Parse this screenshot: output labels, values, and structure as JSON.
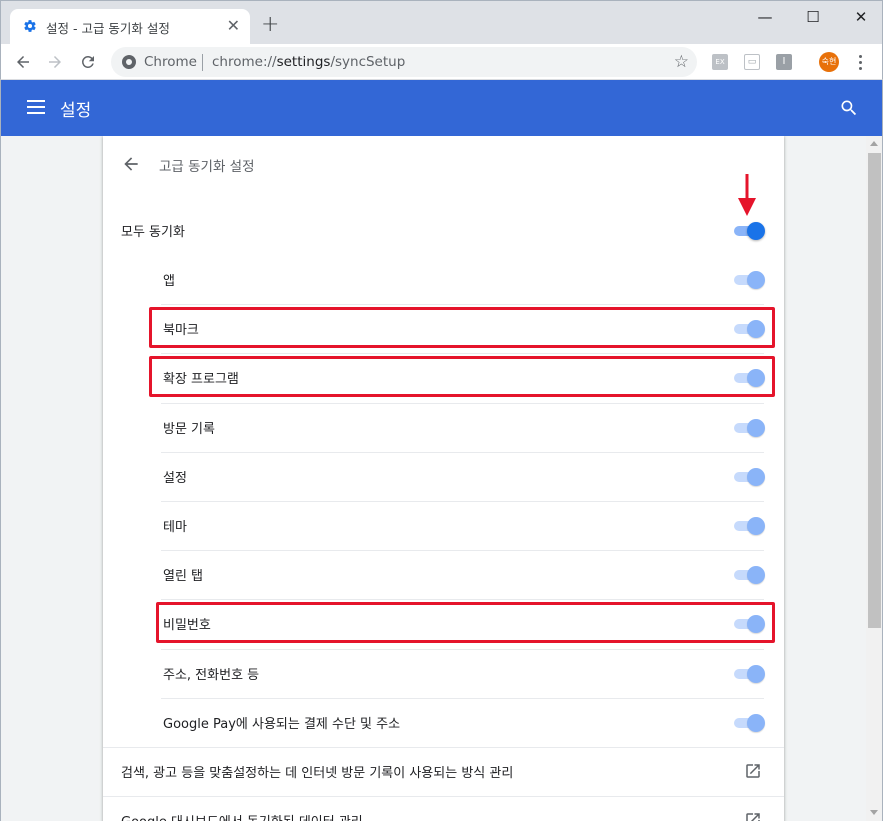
{
  "browser": {
    "tab_title": "설정 - 고급 동기화 설정",
    "tab_close": "✕",
    "new_tab": "+",
    "window_controls": {
      "minimize": "—",
      "maximize": "☐",
      "close": "✕"
    },
    "omnibox": {
      "label": "Chrome",
      "url_prefix": "chrome://",
      "url_host": "settings",
      "url_path": "/syncSetup"
    },
    "extensions": [
      "EX",
      "▭",
      "I"
    ],
    "avatar_text": "숙현"
  },
  "header": {
    "title": "설정"
  },
  "subpage": {
    "title": "고급 동기화 설정"
  },
  "sync_all": {
    "label": "모두 동기화",
    "enabled": true
  },
  "sync_items": [
    {
      "label": "앱",
      "enabled": true,
      "highlighted": false
    },
    {
      "label": "북마크",
      "enabled": true,
      "highlighted": true
    },
    {
      "label": "확장 프로그램",
      "enabled": true,
      "highlighted": true
    },
    {
      "label": "방문 기록",
      "enabled": true,
      "highlighted": false
    },
    {
      "label": "설정",
      "enabled": true,
      "highlighted": false
    },
    {
      "label": "테마",
      "enabled": true,
      "highlighted": false
    },
    {
      "label": "열린 탭",
      "enabled": true,
      "highlighted": false
    },
    {
      "label": "비밀번호",
      "enabled": true,
      "highlighted": true
    },
    {
      "label": "주소, 전화번호 등",
      "enabled": true,
      "highlighted": false
    },
    {
      "label": "Google Pay에 사용되는 결제 수단 및 주소",
      "enabled": true,
      "highlighted": false
    }
  ],
  "links": [
    {
      "label": "검색, 광고 등을 맞춤설정하는 데 인터넷 방문 기록이 사용되는 방식 관리"
    },
    {
      "label": "Google 대시보드에서 동기화된 데이터 관리"
    }
  ],
  "colors": {
    "header": "#3367d6",
    "toggle_on": "#1a73e8",
    "annotation": "#e5142b"
  }
}
